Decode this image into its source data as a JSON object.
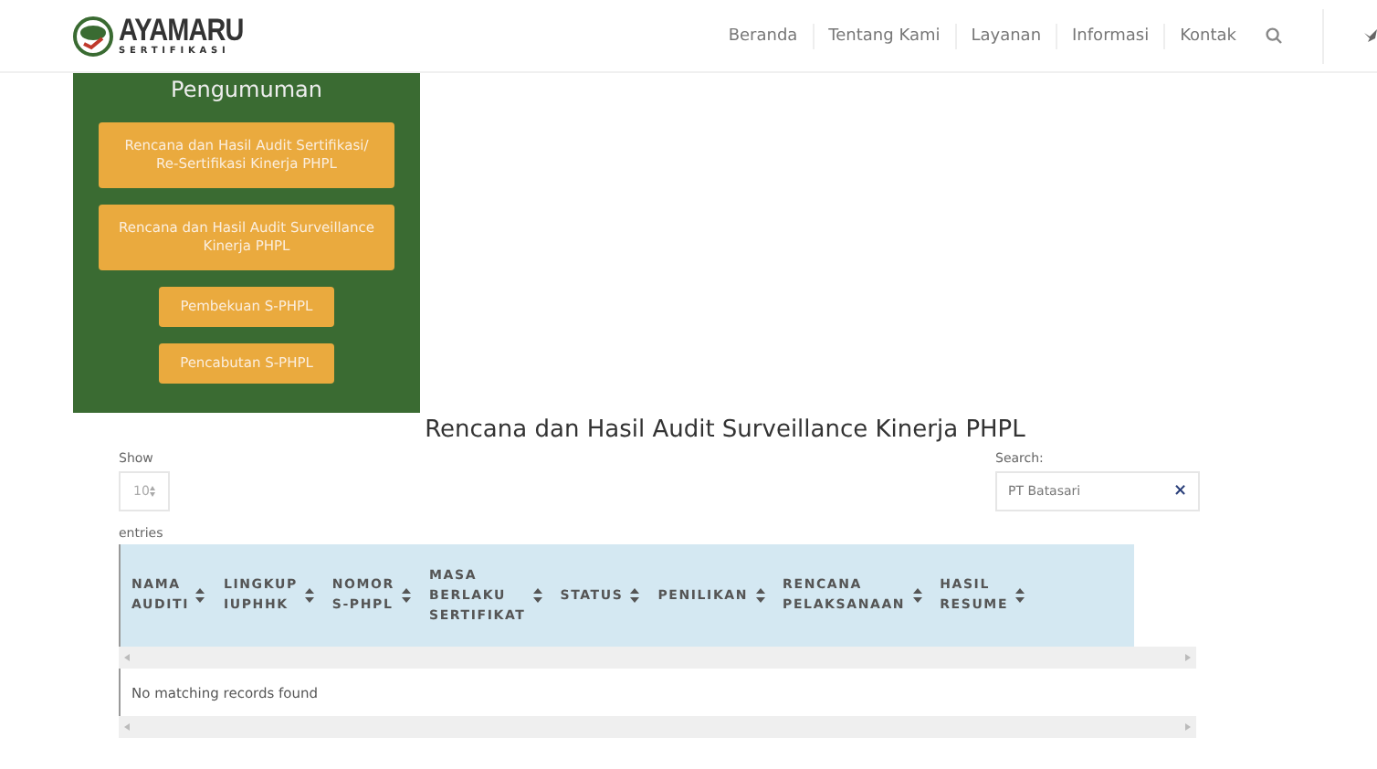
{
  "logo": {
    "name": "AYAMARU",
    "tagline": "SERTIFIKASI"
  },
  "nav": {
    "items": [
      {
        "label": "Beranda",
        "selected": false
      },
      {
        "label": "Tentang Kami",
        "selected": false
      },
      {
        "label": "Layanan",
        "selected": false
      },
      {
        "label": "Informasi",
        "selected": false
      },
      {
        "label": "Kontak",
        "selected": false
      }
    ]
  },
  "announcements": {
    "title": "Pengumuman",
    "links": [
      {
        "label": "Rencana dan Hasil Audit Sertifikasi/ Re-Sertifikasi Kinerja PHPL",
        "kind": "wide"
      },
      {
        "label": "Rencana dan Hasil Audit Surveillance Kinerja PHPL",
        "kind": "wide"
      },
      {
        "label": "Pembekuan S-PHPL",
        "kind": "narrow"
      },
      {
        "label": "Pencabutan S-PHPL",
        "kind": "narrow"
      }
    ]
  },
  "page_title": "Rencana dan Hasil Audit Surveillance Kinerja PHPL",
  "length": {
    "label": "Show",
    "value": "10",
    "suffix": "entries"
  },
  "search": {
    "label": "Search:",
    "value": "PT Batasari",
    "clear": "×"
  },
  "table": {
    "columns": [
      {
        "lines": [
          "NAMA",
          "AUDITI"
        ]
      },
      {
        "lines": [
          "LINGKUP",
          "IUPHHK"
        ]
      },
      {
        "lines": [
          "NOMOR",
          "S-PHPL"
        ]
      },
      {
        "lines": [
          "MASA",
          "BERLAKU",
          "SERTIFIKAT"
        ]
      },
      {
        "lines": [
          "STATUS"
        ]
      },
      {
        "lines": [
          "PENILIKAN"
        ]
      },
      {
        "lines": [
          "RENCANA",
          "PELAKSANAAN"
        ]
      },
      {
        "lines": [
          "HASIL",
          "RESUME"
        ]
      }
    ],
    "empty": "No matching records found"
  }
}
